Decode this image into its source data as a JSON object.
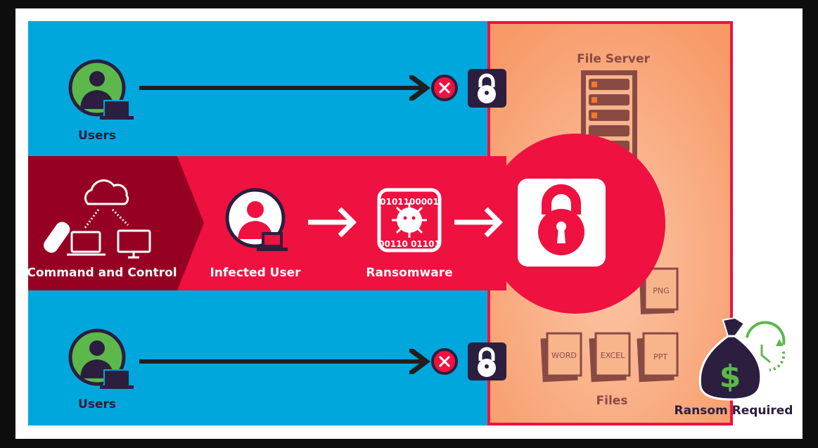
{
  "labels": {
    "users_top": "Users",
    "users_bottom": "Users",
    "command_and_control": "Command and Control",
    "infected_user": "Infected User",
    "ransomware": "Ransomware",
    "file_server": "File Server",
    "files": "Files",
    "ransom_required": "Ransom Required"
  },
  "ransomware_binary": [
    "0101100001",
    "010",
    "010",
    "00",
    "110",
    "010",
    "001",
    "00110 01101"
  ],
  "file_types": [
    "PNG",
    "WORD",
    "EXCEL",
    "PPT"
  ],
  "colors": {
    "blue": "#00a7dc",
    "red": "#ef1140",
    "dark_red": "#960022",
    "orange": "#f9a273",
    "navy": "#2b1e3f",
    "green": "#5cb84a",
    "brown": "#8a4a44"
  }
}
